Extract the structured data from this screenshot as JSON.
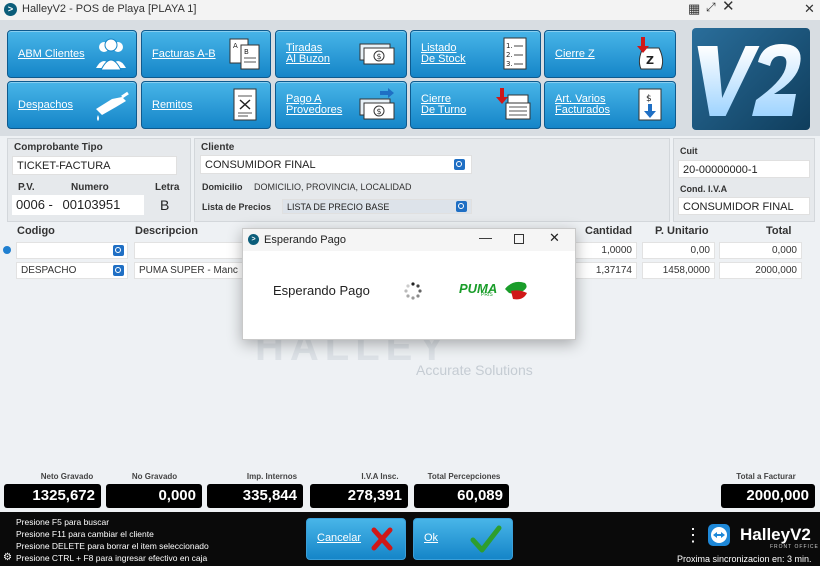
{
  "window": {
    "title": "HalleyV2 - POS de Playa [PLAYA 1]"
  },
  "toolbar": {
    "row1": [
      {
        "label": "ABM Clientes",
        "icon": "users-icon"
      },
      {
        "label": "Facturas A-B",
        "icon": "invoices-icon"
      },
      {
        "label": "Tiradas\nAl Buzon",
        "icon": "cash-bills-icon"
      },
      {
        "label": "Listado\nDe Stock",
        "icon": "stock-list-icon"
      },
      {
        "label": "Cierre Z",
        "icon": "moneybag-icon"
      }
    ],
    "row2": [
      {
        "label": "Despachos",
        "icon": "fuel-nozzle-icon"
      },
      {
        "label": "Remitos",
        "icon": "document-x-icon"
      },
      {
        "label": "Pago A\nProvedores",
        "icon": "cash-transfer-icon"
      },
      {
        "label": "Cierre\nDe Turno",
        "icon": "cash-register-icon"
      },
      {
        "label": "Art. Varios\nFacturados",
        "icon": "document-download-icon"
      }
    ],
    "logo_text": "V2"
  },
  "header": {
    "comprobante_label": "Comprobante Tipo",
    "comprobante_value": "TICKET-FACTURA",
    "pv_label": "P.V.",
    "numero_label": "Numero",
    "letra_label": "Letra",
    "pv_value": "0006",
    "pv_sep": "-",
    "numero_value": "00103951",
    "letra_value": "B",
    "cliente_label": "Cliente",
    "cliente_value": "CONSUMIDOR FINAL",
    "domicilio_label": "Domicilio",
    "domicilio_value": "DOMICILIO, PROVINCIA, LOCALIDAD",
    "lista_label": "Lista de Precios",
    "lista_value": "LISTA DE PRECIO BASE",
    "cuit_label": "Cuit",
    "cuit_value": "20-00000000-1",
    "iva_label": "Cond. I.V.A",
    "iva_value": "CONSUMIDOR FINAL"
  },
  "grid": {
    "columns": {
      "codigo": "Codigo",
      "descripcion": "Descripcion",
      "cantidad": "Cantidad",
      "unitario": "P. Unitario",
      "total": "Total"
    },
    "rows": [
      {
        "codigo": "",
        "descripcion": "",
        "cantidad": "1,0000",
        "unitario": "0,00",
        "total": "0,000"
      },
      {
        "codigo": "DESPACHO",
        "descripcion": "PUMA SUPER - Manc",
        "cantidad": "1,37174",
        "unitario": "1458,0000",
        "total": "2000,000"
      }
    ]
  },
  "watermark": {
    "tagline": "Accurate Solutions"
  },
  "totals": {
    "neto_label": "Neto Gravado",
    "neto_value": "1325,672",
    "nogravado_label": "No Gravado",
    "nogravado_value": "0,000",
    "impint_label": "Imp. Internos",
    "impint_value": "335,844",
    "iva_label": "I.V.A Insc.",
    "iva_value": "278,391",
    "percep_label": "Total Percepciones",
    "percep_value": "60,089",
    "total_label": "Total a Facturar",
    "total_value": "2000,000"
  },
  "bottom": {
    "hints": [
      "Presione F5 para buscar",
      "Presione F11 para cambiar el cliente",
      "Presione DELETE para borrar el item seleccionado",
      "Presione CTRL + F8 para ingresar efectivo en caja"
    ],
    "cancel_label": "Cancelar",
    "ok_label": "Ok",
    "brand": "HalleyV2",
    "brand_sub": "FRONT OFFICE",
    "sync_text": "Proxima sincronizacion en: 3 min."
  },
  "dialog": {
    "title": "Esperando Pago",
    "message": "Esperando Pago",
    "brand": "PUMA",
    "brand_sub": "PRIS"
  },
  "colors": {
    "accent": "#1585c8",
    "dark": "#0a0a0a",
    "check": "#2e9e2e",
    "cancel_x": "#d01818"
  }
}
